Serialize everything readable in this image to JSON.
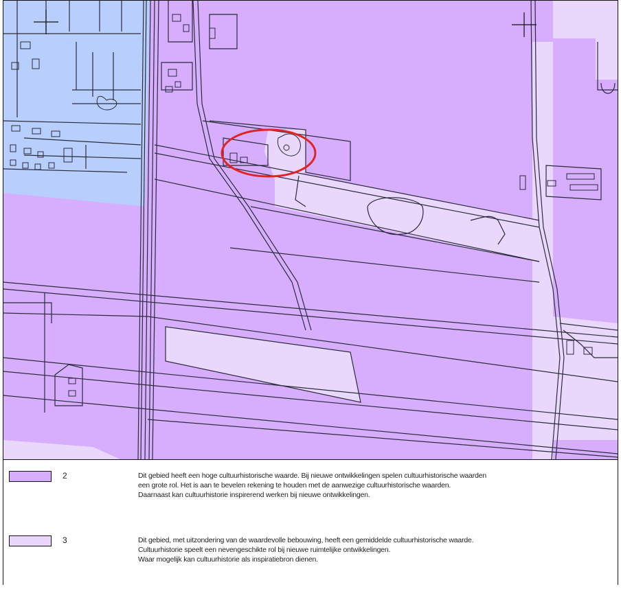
{
  "colors": {
    "class_2": "#d7adfd",
    "class_3": "#ead8fc",
    "built_area": "#b8cefc",
    "highlight": "#e02424",
    "lines": "#2b2b3a"
  },
  "legend": [
    {
      "class": "2",
      "lines": [
        "Dit gebied heeft een hoge cultuurhistorische waarde. Bij nieuwe ontwikkelingen spelen cultuurhistorische waarden",
        "een grote rol. Het is aan te bevelen rekening te houden met de aanwezige cultuurhistorische waarden.",
        "Daarnaast kan cultuurhistorie inspirerend werken bij nieuwe ontwikkelingen."
      ]
    },
    {
      "class": "3",
      "lines": [
        "Dit gebied, met uitzondering van de waardevolle bebouwing, heeft een gemiddelde cultuurhistorische waarde.",
        "Cultuurhistorie speelt een nevengeschikte rol bij nieuwe ruimtelijke ontwikkelingen.",
        "Waar mogelijk kan cultuurhistorie als inspiratiebron dienen."
      ]
    }
  ]
}
